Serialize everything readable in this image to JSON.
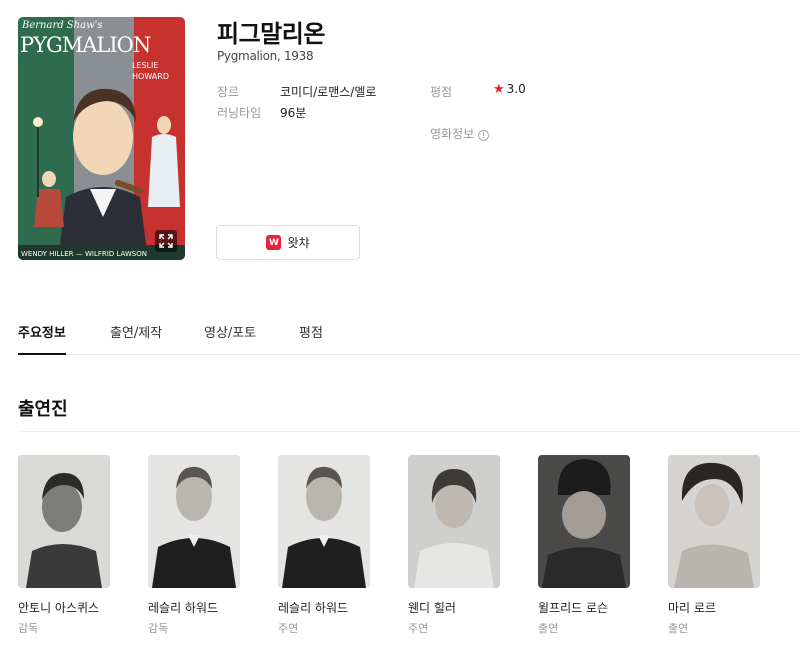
{
  "movie": {
    "title": "피그말리온",
    "subtitle": "Pygmalion, 1938",
    "poster": {
      "header_text": "Bernard Shaw's",
      "title_text": "PYGMALION",
      "star_text": "LESLIE HOWARD",
      "footer_text": "WENDY HILLER — WILFRID LAWSON"
    },
    "meta": {
      "genre_label": "장르",
      "genre_value": "코미디/로맨스/멜로",
      "runtime_label": "러닝타임",
      "runtime_value": "96분",
      "rating_label": "평점",
      "rating_star": "★",
      "rating_value": "3.0",
      "movieinfo_label": "영화정보",
      "info_icon": "!"
    },
    "watcha": {
      "logo": "W",
      "label": "왓챠"
    }
  },
  "tabs": [
    {
      "label": "주요정보",
      "active": true
    },
    {
      "label": "출연/제작",
      "active": false
    },
    {
      "label": "영상/포토",
      "active": false
    },
    {
      "label": "평점",
      "active": false
    }
  ],
  "cast_section": {
    "title": "출연진",
    "members": [
      {
        "name": "안토니 아스퀴스",
        "role": "감독"
      },
      {
        "name": "레슬리 하워드",
        "role": "감독"
      },
      {
        "name": "레슬리 하워드",
        "role": "주연"
      },
      {
        "name": "웬디 힐러",
        "role": "주연"
      },
      {
        "name": "윌프리드 로슨",
        "role": "출연"
      },
      {
        "name": "마리 로르",
        "role": "출연"
      }
    ]
  },
  "colors": {
    "accent_red": "#e8202a",
    "watcha_brand": "#e6233c",
    "poster_green": "#2f6b4f",
    "poster_red": "#c8322e"
  }
}
